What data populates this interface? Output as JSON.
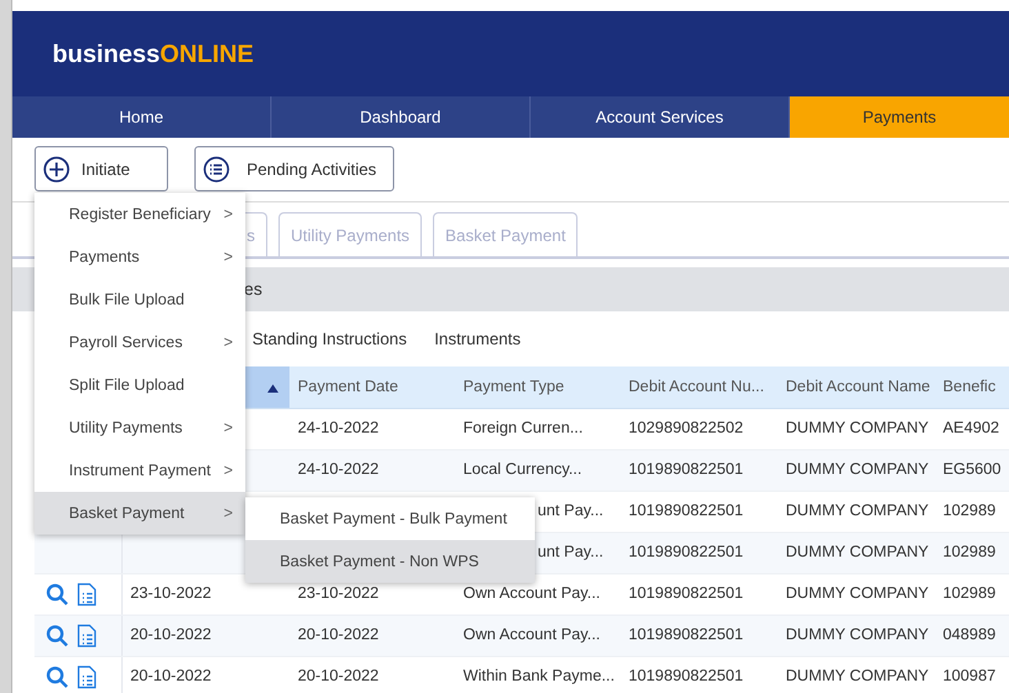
{
  "header": {
    "logo_main": "business",
    "logo_accent": "ONLINE"
  },
  "nav": [
    {
      "label": "Home",
      "selected": false
    },
    {
      "label": "Dashboard",
      "selected": false
    },
    {
      "label": "Account Services",
      "selected": false
    },
    {
      "label": "Payments",
      "selected": true
    }
  ],
  "toolbar": [
    {
      "label": "Initiate",
      "kind": "plus"
    },
    {
      "label": "Pending Activities",
      "kind": "list"
    }
  ],
  "tabs": [
    {
      "label": "s"
    },
    {
      "label": "Utility Payments"
    },
    {
      "label": "Basket Payment"
    }
  ],
  "section_bar": {
    "title": "es"
  },
  "sub_tabs": [
    "Standing Instructions",
    "Instruments"
  ],
  "table": {
    "columns": [
      {
        "sorted": true
      },
      {
        "label": "Payment Date",
        "sorted": false
      },
      {
        "label": "Payment Type",
        "sorted": false
      },
      {
        "label": "Debit Account Nu...",
        "sorted": false
      },
      {
        "label": "Debit Account Name",
        "sorted": false
      },
      {
        "label": "Benefic",
        "sorted": false
      }
    ],
    "rows": [
      {
        "partial_type": false,
        "payment_date": "24-10-2022",
        "payment_type": "Foreign Curren...",
        "debit_account_number": "1029890822502",
        "debit_account_name": "DUMMY COMPANY",
        "column_6": "AE4902"
      },
      {
        "partial_type": false,
        "payment_date": "24-10-2022",
        "payment_type": "Local Currency...",
        "debit_account_number": "1019890822501",
        "debit_account_name": "DUMMY COMPANY",
        "column_6": "EG5600"
      },
      {
        "partial_type": true,
        "payment_type": "unt Pay...",
        "debit_account_number": "1019890822501",
        "debit_account_name": "DUMMY COMPANY",
        "column_6": "102989"
      },
      {
        "partial_type": true,
        "payment_type": "unt Pay...",
        "debit_account_number": "1019890822501",
        "debit_account_name": "DUMMY COMPANY",
        "column_6": "102989"
      },
      {
        "actions": true,
        "partial_type": false,
        "column_2": "23-10-2022",
        "payment_date": "23-10-2022",
        "payment_type": "Own Account Pay...",
        "debit_account_number": "1019890822501",
        "debit_account_name": "DUMMY COMPANY",
        "column_6": "102989"
      },
      {
        "actions": true,
        "partial_type": false,
        "column_2": "20-10-2022",
        "payment_date": "20-10-2022",
        "payment_type": "Own Account Pay...",
        "debit_account_number": "1019890822501",
        "debit_account_name": "DUMMY COMPANY",
        "column_6": "048989"
      },
      {
        "actions": true,
        "partial_type": false,
        "column_2": "20-10-2022",
        "payment_date": "20-10-2022",
        "payment_type": "Within Bank Payme...",
        "debit_account_number": "1019890822501",
        "debit_account_name": "DUMMY COMPANY",
        "column_6": "100987"
      }
    ]
  },
  "menu": {
    "items": [
      {
        "label": "Register Beneficiary",
        "has_submenu": true,
        "selected": false
      },
      {
        "label": "Payments",
        "has_submenu": true,
        "selected": false
      },
      {
        "label": "Bulk File Upload",
        "has_submenu": false,
        "selected": false
      },
      {
        "label": "Payroll Services",
        "has_submenu": true,
        "selected": false
      },
      {
        "label": "Split File Upload",
        "has_submenu": false,
        "selected": false
      },
      {
        "label": "Utility Payments",
        "has_submenu": true,
        "selected": false
      },
      {
        "label": "Instrument Payment",
        "has_submenu": true,
        "selected": false
      },
      {
        "label": "Basket Payment",
        "has_submenu": true,
        "selected": true
      }
    ],
    "chevron": ">",
    "submenu": [
      {
        "label": "Basket Payment - Bulk Payment",
        "selected": false
      },
      {
        "label": "Basket Payment - Non WPS",
        "selected": true
      }
    ]
  }
}
